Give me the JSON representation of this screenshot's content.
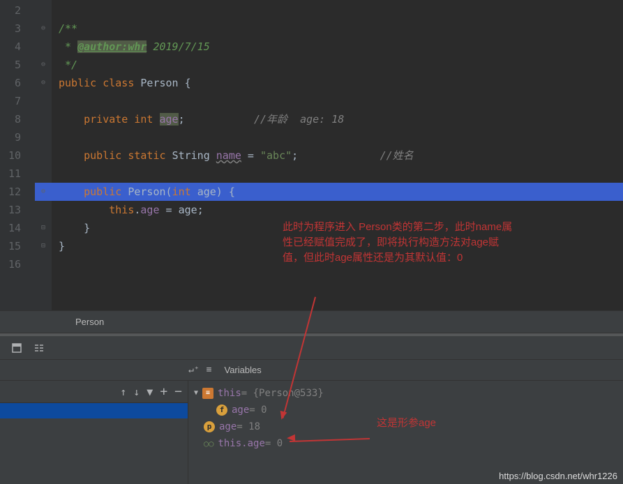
{
  "gutter": [
    "2",
    "3",
    "4",
    "5",
    "6",
    "7",
    "8",
    "9",
    "10",
    "11",
    "12",
    "13",
    "14",
    "15",
    "16"
  ],
  "code": {
    "l3_open": "/**",
    "l4_star": " * ",
    "l4_tag": "@author:whr",
    "l4_date": " 2019/7/15",
    "l5_close": " */",
    "l6_pub": "public ",
    "l6_class": "class ",
    "l6_name": "Person ",
    "l6_brace": "{",
    "l8_priv": "private ",
    "l8_int": "int ",
    "l8_age": "age",
    "l8_semi": ";",
    "l8_com": "//年龄  age: 18",
    "l10_pub": "public ",
    "l10_static": "static ",
    "l10_string": "String ",
    "l10_name": "name",
    "l10_eq": " = ",
    "l10_val": "\"abc\"",
    "l10_semi": ";",
    "l10_com": "//姓名",
    "l12_pub": "public ",
    "l12_ctor": "Person",
    "l12_paren": "(",
    "l12_int": "int ",
    "l12_age": "age",
    "l12_close": ") {",
    "l13_this": "this",
    "l13_dot": ".",
    "l13_age1": "age",
    "l13_eq": " = ",
    "l13_age2": "age",
    "l13_semi": ";",
    "l14_brace": "}",
    "l15_brace": "}"
  },
  "tab": "Person",
  "annotation1": "此时为程序进入 Person类的第二步，此时name属性已经赋值完成了，即将执行构造方法对age赋值，但此时age属性还是为其默认值：0",
  "annotation2": "这是形参age",
  "vars_label": "Variables",
  "vars": {
    "this_name": "this",
    "this_val": " = {Person@533}",
    "age_f_name": "age",
    "age_f_val": " = 0",
    "age_p_name": "age",
    "age_p_val": " = 18",
    "thisage_name": "this.age",
    "thisage_val": " = 0"
  },
  "watermark": "https://blog.csdn.net/whr1226"
}
